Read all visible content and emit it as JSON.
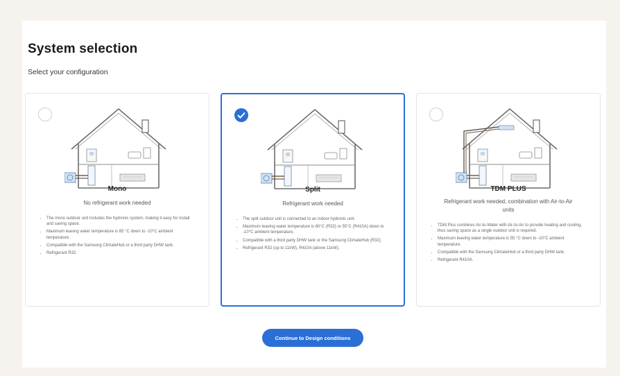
{
  "page": {
    "title": "System selection",
    "subtitle": "Select your configuration"
  },
  "cards": [
    {
      "name": "Mono",
      "description": "No refrigerant work needed",
      "selected": false,
      "bullets": [
        "The mono outdoor unit includes the hydronic system, making it easy for install and saving space.",
        "Maximum leaving water temperature is 65 °C down to -10°C ambient temperature.",
        "Compatible with the Samsung ClimateHub or a third party DHW tank.",
        "Refrigerant R32."
      ]
    },
    {
      "name": "Split",
      "description": "Refrigerant work needed",
      "selected": true,
      "bullets": [
        "The split outdoor unit is connected to an indoor hydronic unit.",
        "Maximum leaving water temperature is 60°C (R32) or 55°C (R410A) down to -10°C ambient temperature.",
        "Compatible with a third party DHW tank or the Samsung ClimateHub (R32).",
        "Refrigerant R32 (up to 11kW), R410A (above 11kW)."
      ]
    },
    {
      "name": "TDM PLUS",
      "description": "Refrigerant work needed, combination with Air-to-Air units",
      "selected": false,
      "bullets": [
        "TDM Plus combines Air-to-Water with Air-to-Air to provide heating and cooling, thus saving space as a single outdoor unit is required.",
        "Maximum leaving water temperature is 55 °C down to -10°C ambient temperature.",
        "Compatible with the Samsung ClimateHub or a third party DHW tank.",
        "Refrigerant R410A."
      ]
    }
  ],
  "cta": {
    "label": "Continue to Design conditions"
  },
  "colors": {
    "accent": "#2a6fd6",
    "background": "#f6f3ef"
  }
}
